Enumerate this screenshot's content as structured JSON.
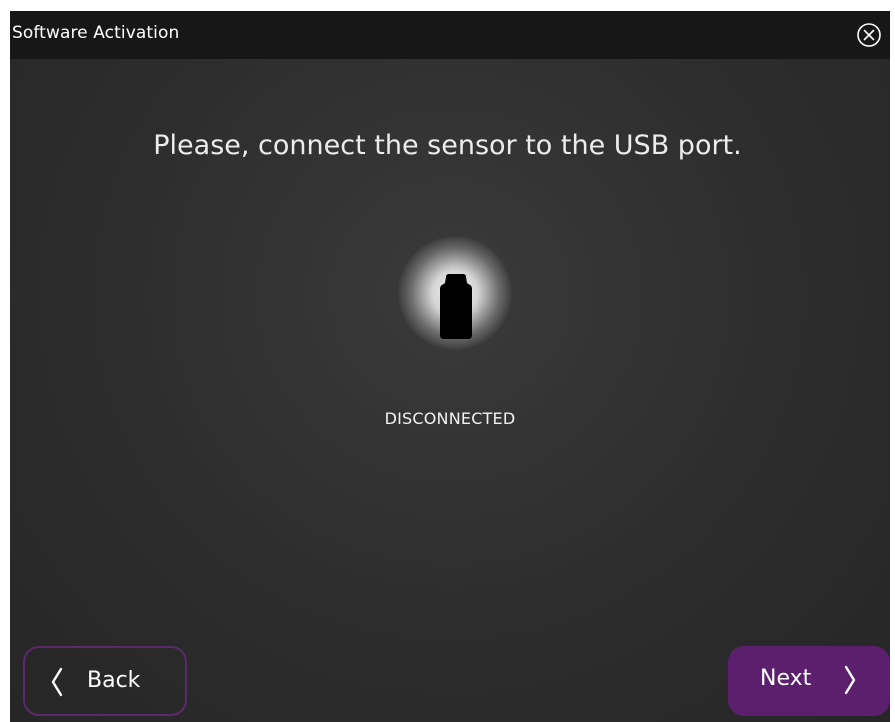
{
  "window": {
    "title": "Software Activation",
    "close_icon": "close-circle-icon"
  },
  "main": {
    "instruction": "Please, connect the sensor to the USB port.",
    "sensor_icon": "usb-sensor-icon",
    "status": "DISCONNECTED"
  },
  "footer": {
    "back_label": "Back",
    "next_label": "Next"
  },
  "colors": {
    "background": "#2d2d2d",
    "title_bar": "#171717",
    "accent_purple": "#5b1f6d",
    "back_border": "#5c2a6b"
  }
}
